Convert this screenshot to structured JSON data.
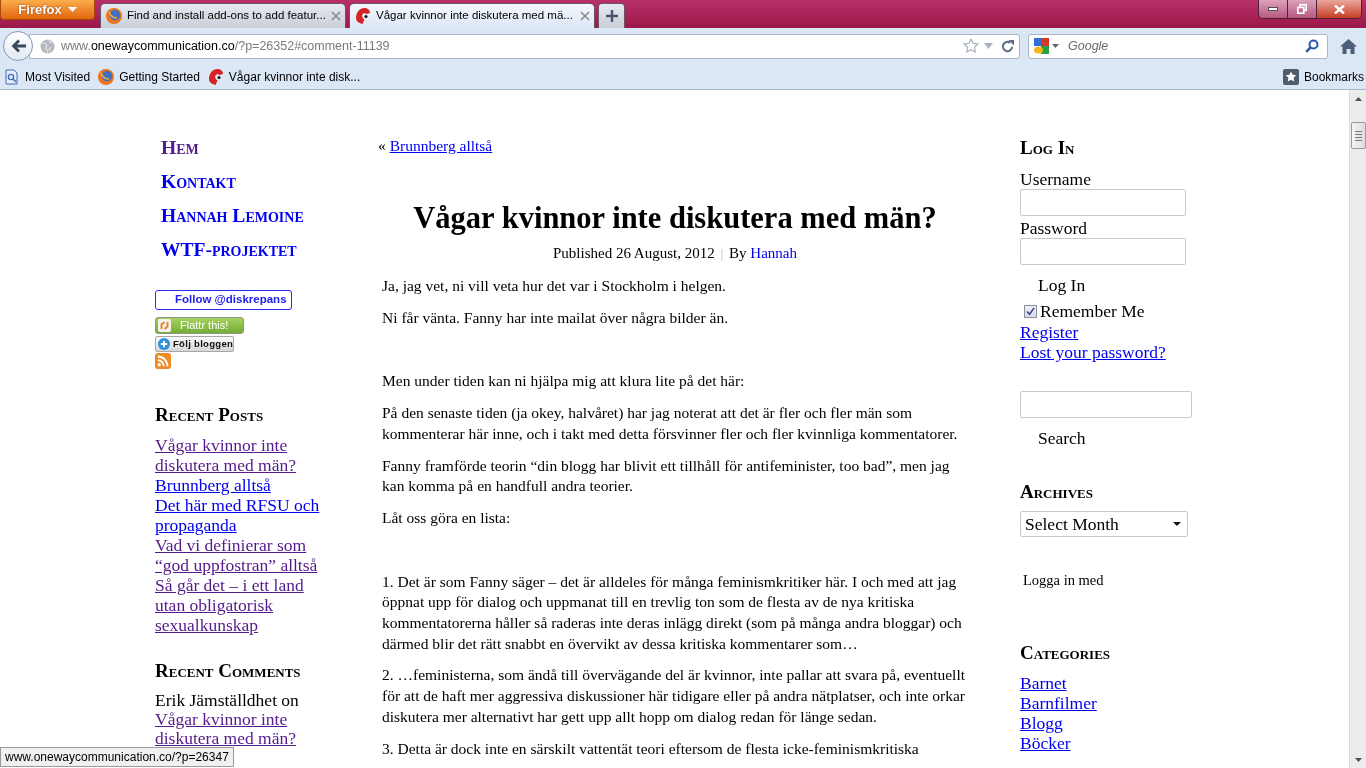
{
  "browser": {
    "menu_button": "Firefox",
    "tabs": [
      {
        "title": "Find and install add-ons to add featur...",
        "selected": false,
        "kind": "browser"
      },
      {
        "title": "Vågar kvinnor inte diskutera med mä...",
        "selected": true,
        "kind": "site"
      }
    ],
    "address": {
      "prefix": "www.",
      "domain": "onewaycommunication.co",
      "path": "/?p=26352#comment-11139"
    },
    "search": {
      "placeholder": "Google"
    },
    "bookmarks": [
      {
        "label": "Most Visited",
        "kind": "folder"
      },
      {
        "label": "Getting Started",
        "kind": "browser"
      },
      {
        "label": "Vågar kvinnor inte disk...",
        "kind": "site"
      }
    ],
    "bookmarks_menu": "Bookmarks",
    "status": "www.onewaycommunication.co/?p=26347"
  },
  "page": {
    "nav": [
      {
        "label": "Hem",
        "visited": true
      },
      {
        "label": "Kontakt",
        "visited": false
      },
      {
        "label": "Hannah Lemoine",
        "visited": false
      },
      {
        "label": "WTF-projektet",
        "visited": false
      }
    ],
    "badges": [
      {
        "kind": "follow",
        "label": "Follow @diskrepans"
      },
      {
        "kind": "flattr",
        "label": "Flattr this!"
      },
      {
        "kind": "subscribe",
        "label": "Följ bloggen"
      },
      {
        "kind": "rss"
      }
    ],
    "recent_posts": {
      "title": "Recent Posts",
      "items": [
        {
          "label": "Vågar kvinnor inte diskutera med män?",
          "visited": true
        },
        {
          "label": "Brunnberg alltså",
          "visited": false
        },
        {
          "label": "Det här med RFSU och propaganda",
          "visited": false
        },
        {
          "label": "Vad vi definierar som “god uppfostran” alltså",
          "visited": true
        },
        {
          "label": "Så går det – i ett land utan obligatorisk sexualkunskap",
          "visited": true
        }
      ]
    },
    "recent_comments": {
      "title": "Recent Comments",
      "items": [
        {
          "byline": "Erik Jämställdhet on",
          "post": "Vågar kvinnor inte diskutera med män?",
          "visited": true
        }
      ]
    },
    "post": {
      "previous": {
        "marker": "«",
        "label": "Brunnberg alltså"
      },
      "title": "Vågar kvinnor inte diskutera med män?",
      "published": "Published 26 August, 2012",
      "separator": "|",
      "by": "By",
      "author": "Hannah",
      "sections": [
        [
          "Ja, jag vet, ni vill veta hur det var i Stockholm i helgen.",
          "Ni får vänta. Fanny har inte mailat över några bilder än."
        ],
        [
          "Men under tiden kan ni hjälpa mig att klura lite på det här:",
          "På den senaste tiden (ja okey, halvåret) har jag noterat att det är fler och fler män som kommenterar här inne, och i takt med detta försvinner fler och fler kvinnliga kommentatorer.",
          "Fanny framförde teorin “din blogg har blivit ett tillhåll för antifeminister, too bad”, men jag kan komma på en handfull andra teorier.",
          "Låt oss göra en lista:"
        ],
        [
          "1. Det är som Fanny säger – det är alldeles för många feminismkritiker här. I och med att jag öppnat upp för dialog och uppmanat till en trevlig ton som de flesta av de nya kritiska kommentatorerna håller så raderas inte deras inlägg direkt (som på många andra bloggar) och därmed blir det rätt snabbt en övervikt av dessa kritiska kommentarer som…",
          "2. …feministerna, som ändå till övervägande del är kvinnor, inte pallar att svara på, eventuellt för att de haft mer aggressiva diskussioner här tidigare eller på andra nätplatser, och inte orkar diskutera mer alternativt har gett upp allt hopp om dialog redan för länge sedan.",
          "3. Detta är dock inte en särskilt vattentät teori eftersom de flesta icke-feminismkritiska"
        ]
      ]
    },
    "sidebar": {
      "login": {
        "title": "Log In",
        "username_label": "Username",
        "password_label": "Password",
        "submit": "Log In",
        "remember": {
          "label": "Remember Me",
          "checked": true
        },
        "links": [
          "Register",
          "Lost your password?"
        ]
      },
      "search": {
        "button": "Search"
      },
      "archives": {
        "title": "Archives",
        "select": "Select Month"
      },
      "social_login": "Logga in med",
      "categories": {
        "title": "Categories",
        "items": [
          {
            "label": "Barnet",
            "visited": false
          },
          {
            "label": "Barnfilmer",
            "visited": false
          },
          {
            "label": "Blogg",
            "visited": false
          },
          {
            "label": "Böcker",
            "visited": false
          }
        ]
      }
    }
  }
}
